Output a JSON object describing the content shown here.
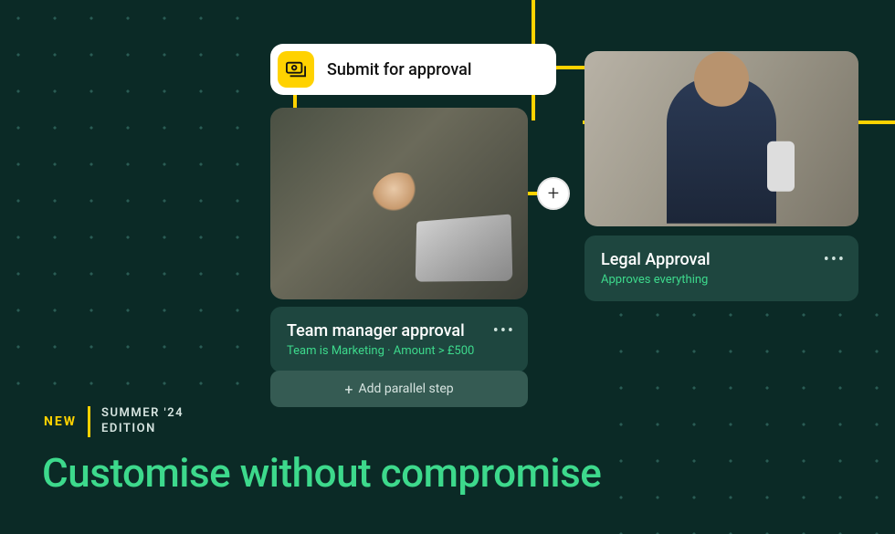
{
  "submit": {
    "label": "Submit for approval"
  },
  "cards": {
    "team_manager": {
      "title": "Team manager approval",
      "subtitle": "Team is Marketing · Amount > £500"
    },
    "legal": {
      "title": "Legal Approval",
      "subtitle": "Approves everything"
    }
  },
  "add_step": {
    "label": "Add parallel step"
  },
  "edition": {
    "new": "NEW",
    "line1": "SUMMER '24",
    "line2": "EDITION"
  },
  "headline": "Customise without compromise"
}
